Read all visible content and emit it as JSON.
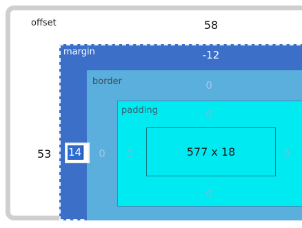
{
  "offset": {
    "label": "offset",
    "top": "58",
    "left": "53"
  },
  "margin": {
    "label": "margin",
    "top": "-12",
    "left_input_value": "14"
  },
  "border": {
    "label": "border",
    "top": "0",
    "left": "0"
  },
  "padding": {
    "label": "padding",
    "top": "0",
    "left": "0",
    "right": "0",
    "bottom": "0"
  },
  "content": {
    "size": "577 x 18"
  },
  "colors": {
    "margin": "#3b6fc8",
    "border": "#5bafdd",
    "padding": "#00eaf2",
    "frame": "#cfcfcf"
  }
}
